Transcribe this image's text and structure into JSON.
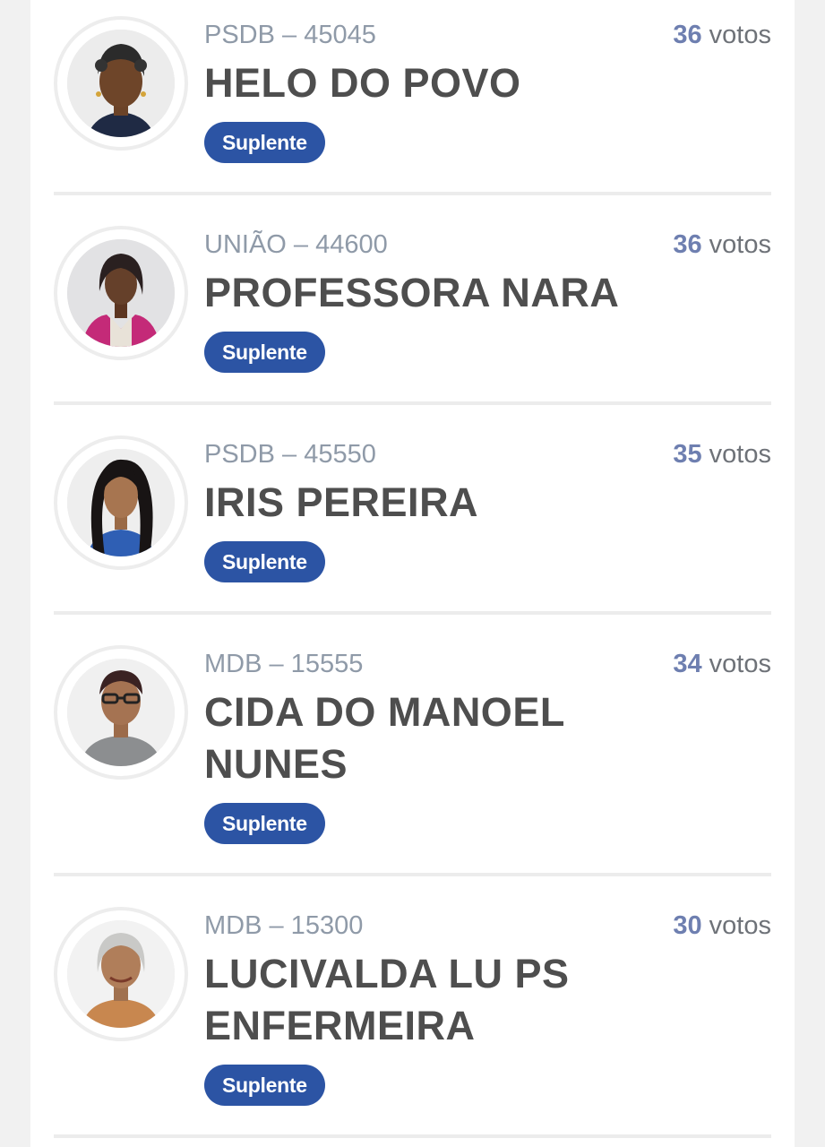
{
  "candidates": [
    {
      "party": "PSDB – 45045",
      "name": "HELO DO POVO",
      "votes_number": "36",
      "votes_label": "votos",
      "status": "Suplente"
    },
    {
      "party": "UNIÃO – 44600",
      "name": "PROFESSORA NARA",
      "votes_number": "36",
      "votes_label": "votos",
      "status": "Suplente"
    },
    {
      "party": "PSDB – 45550",
      "name": "IRIS PEREIRA",
      "votes_number": "35",
      "votes_label": "votos",
      "status": "Suplente"
    },
    {
      "party": "MDB – 15555",
      "name": "CIDA DO MANOEL NUNES",
      "votes_number": "34",
      "votes_label": "votos",
      "status": "Suplente"
    },
    {
      "party": "MDB – 15300",
      "name": "LUCIVALDA LU PS ENFERMEIRA",
      "votes_number": "30",
      "votes_label": "votos",
      "status": "Suplente"
    }
  ],
  "colors": {
    "badge": "#2c54a4",
    "vote_number": "#6e7fb0",
    "party_text": "#8f9aa8",
    "name_text": "#4e4e4e"
  }
}
